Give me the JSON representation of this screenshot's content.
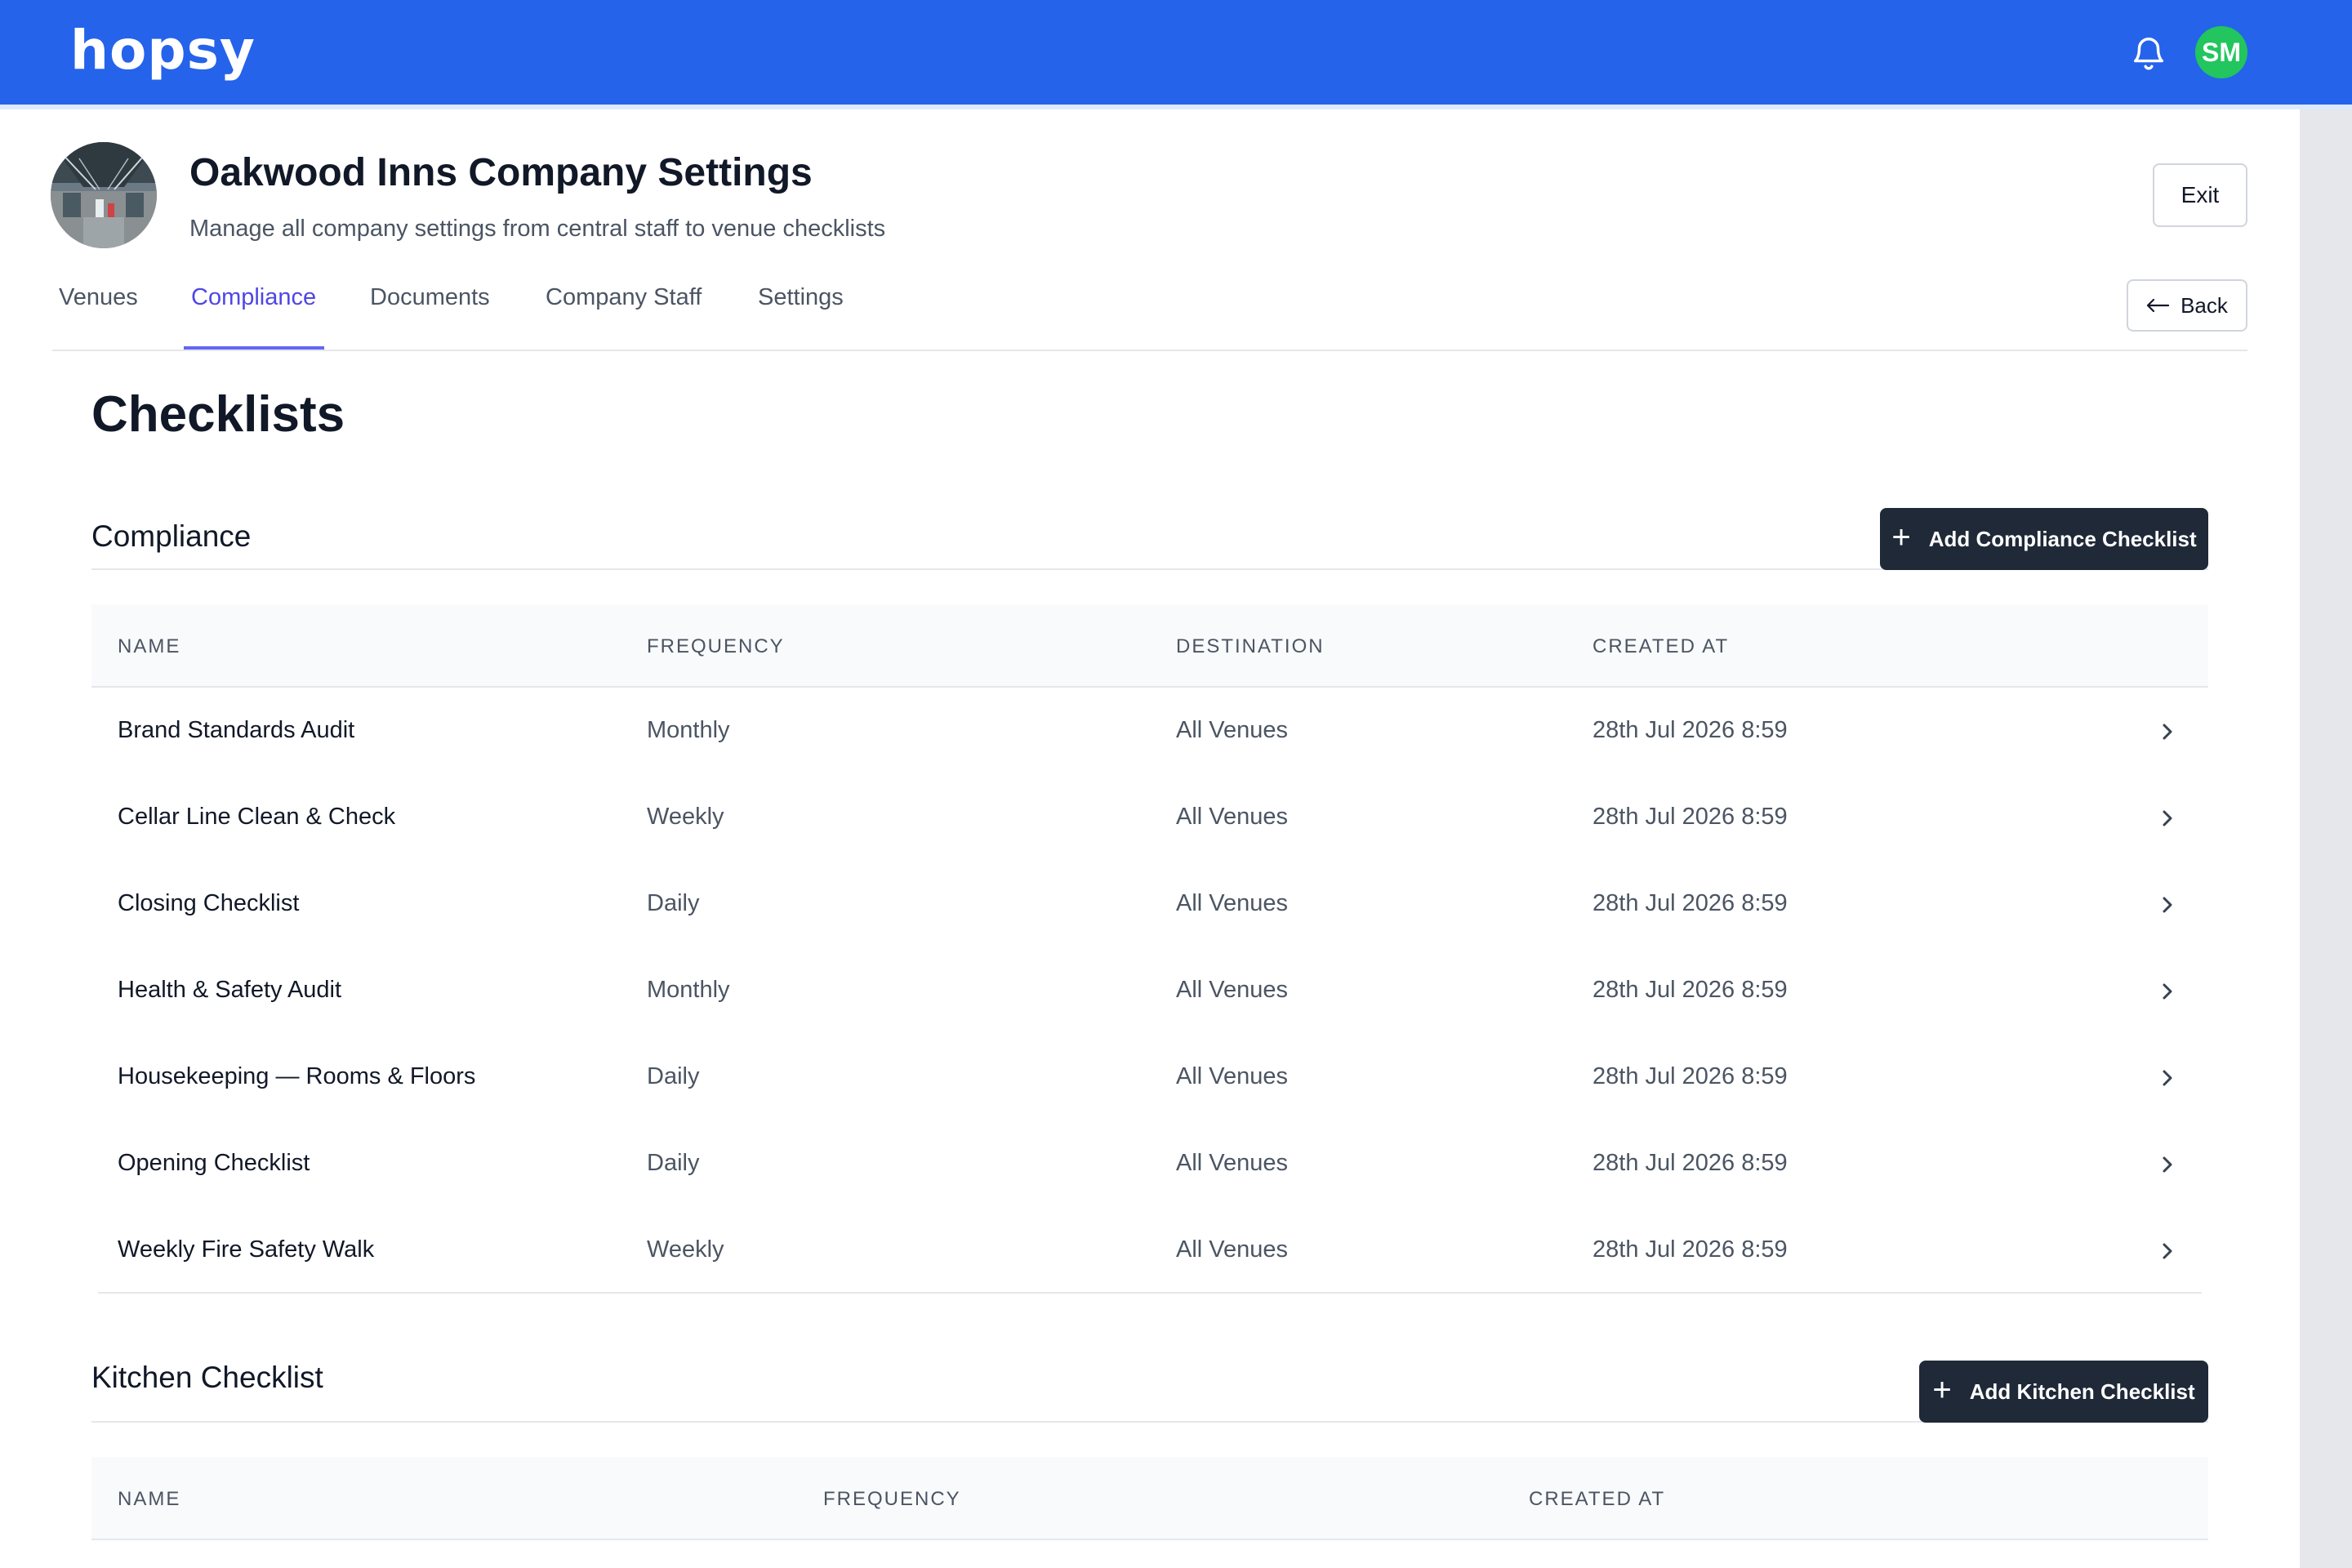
{
  "header": {
    "logo_text": "hopsy",
    "avatar_initials": "SM",
    "brand_color": "#2563eb",
    "icons": [
      "bell-icon"
    ]
  },
  "company": {
    "title": "Oakwood Inns Company Settings",
    "subtitle": "Manage all company settings from central staff to venue checklists",
    "exit_label": "Exit",
    "back_label": "Back"
  },
  "tabs": [
    {
      "label": "Venues",
      "active": false
    },
    {
      "label": "Compliance",
      "active": true
    },
    {
      "label": "Documents",
      "active": false
    },
    {
      "label": "Company Staff",
      "active": false
    },
    {
      "label": "Settings",
      "active": false
    }
  ],
  "page": {
    "heading": "Checklists"
  },
  "compliance": {
    "title": "Compliance",
    "add_label": "Add Compliance Checklist",
    "columns": [
      "NAME",
      "FREQUENCY",
      "DESTINATION",
      "CREATED AT"
    ],
    "rows": [
      {
        "name": "Brand Standards Audit",
        "frequency": "Monthly",
        "destination": "All Venues",
        "created": "28th Jul 2026 8:59"
      },
      {
        "name": "Cellar Line Clean & Check",
        "frequency": "Weekly",
        "destination": "All Venues",
        "created": "28th Jul 2026 8:59"
      },
      {
        "name": "Closing Checklist",
        "frequency": "Daily",
        "destination": "All Venues",
        "created": "28th Jul 2026 8:59"
      },
      {
        "name": "Health & Safety Audit",
        "frequency": "Monthly",
        "destination": "All Venues",
        "created": "28th Jul 2026 8:59"
      },
      {
        "name": "Housekeeping — Rooms & Floors",
        "frequency": "Daily",
        "destination": "All Venues",
        "created": "28th Jul 2026 8:59"
      },
      {
        "name": "Opening Checklist",
        "frequency": "Daily",
        "destination": "All Venues",
        "created": "28th Jul 2026 8:59"
      },
      {
        "name": "Weekly Fire Safety Walk",
        "frequency": "Weekly",
        "destination": "All Venues",
        "created": "28th Jul 2026 8:59"
      }
    ]
  },
  "kitchen": {
    "title": "Kitchen Checklist",
    "add_label": "Add Kitchen Checklist",
    "columns": [
      "NAME",
      "FREQUENCY",
      "CREATED AT"
    ]
  }
}
